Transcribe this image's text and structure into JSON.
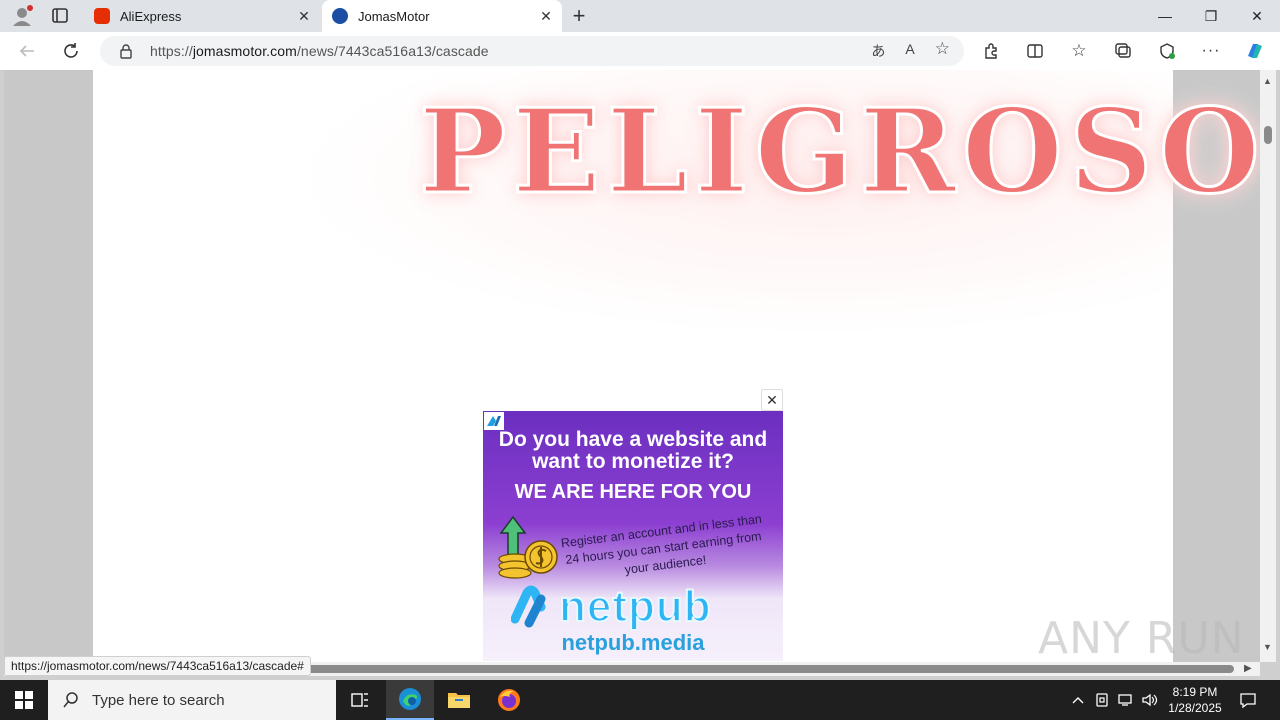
{
  "browser": {
    "tabs": [
      {
        "title": "AliExpress",
        "active": false,
        "favicon_color": "#e62e04"
      },
      {
        "title": "JomasMotor",
        "active": true,
        "favicon_color": "#1c4fa3"
      }
    ],
    "new_tab_label": "+",
    "url_prefix": "https://",
    "url_host": "jomasmotor.com",
    "url_path": "/news/7443ca516a13/cascade",
    "window_controls": {
      "minimize": "—",
      "maximize": "❐",
      "close": "✕"
    }
  },
  "page": {
    "hero_top_text": "",
    "hero_main_text": "PELIGROSO!",
    "hero_color": "#f07474"
  },
  "ad": {
    "close_label": "✕",
    "headline": "Do you have a website and want to monetize it?",
    "subheadline": "WE ARE HERE FOR YOU",
    "body": "Register an account and in less than 24 hours you can start earning from your audience!",
    "brand": "netpub",
    "domain": "netpub.media"
  },
  "status_url": "https://jomasmotor.com/news/7443ca516a13/cascade#",
  "watermark": "ANY RUN",
  "taskbar": {
    "search_placeholder": "Type here to search",
    "time": "8:19 PM",
    "date": "1/28/2025"
  }
}
